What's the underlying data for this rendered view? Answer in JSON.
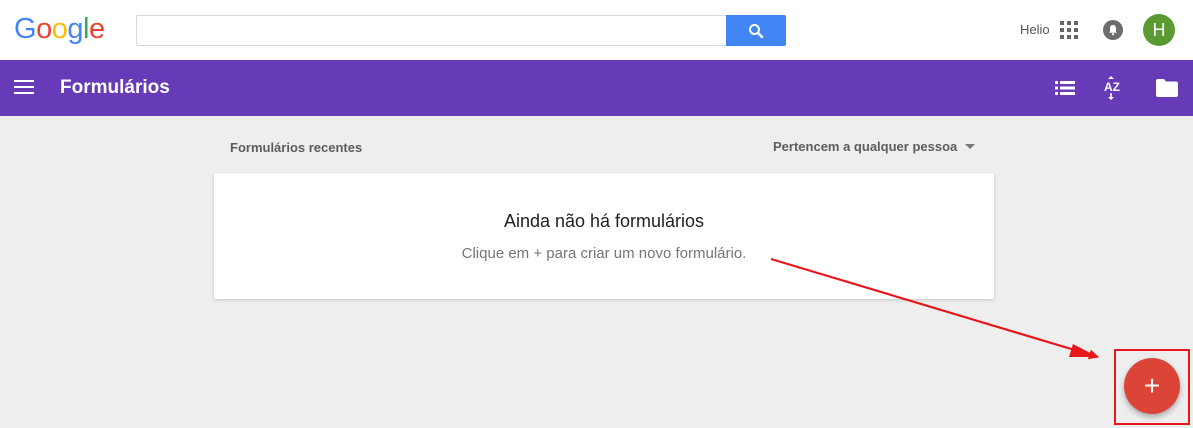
{
  "header": {
    "logo_letters": [
      "G",
      "o",
      "o",
      "g",
      "l",
      "e"
    ],
    "logo_colors": [
      "#4285f4",
      "#ea4335",
      "#fbbc05",
      "#4285f4",
      "#34a853",
      "#ea4335"
    ],
    "search_value": "",
    "search_icon": "search-icon",
    "user_name": "Helio",
    "apps_icon": "apps-grid-icon",
    "notifications_icon": "bell-icon",
    "avatar_initial": "H"
  },
  "appbar": {
    "background": "#673ab7",
    "menu_icon": "hamburger-menu-icon",
    "title": "Formulários",
    "actions": [
      "list-view-icon",
      "sort-az-icon",
      "folder-icon"
    ]
  },
  "main": {
    "section_label": "Formulários recentes",
    "owner_filter": "Pertencem a qualquer pessoa",
    "empty_title": "Ainda não há formulários",
    "empty_subtitle": "Clique em + para criar um novo formulário."
  },
  "fab": {
    "label": "+",
    "color": "#db4437",
    "icon": "plus-icon"
  },
  "annotation": {
    "color": "#e8161b"
  }
}
